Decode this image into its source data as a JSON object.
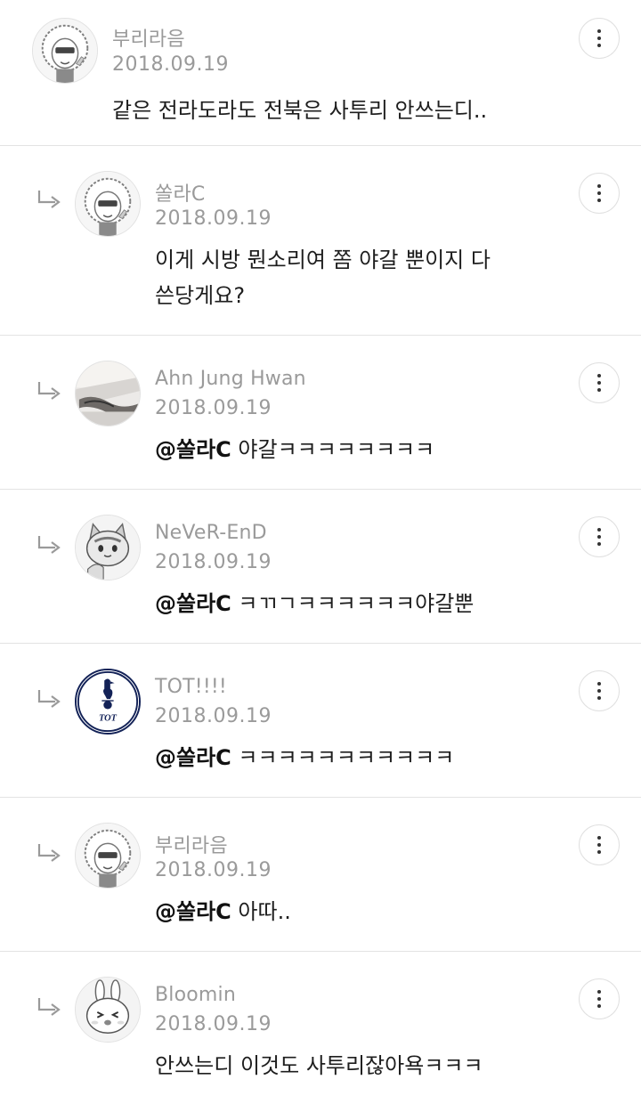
{
  "comments": [
    {
      "author": "부리라음",
      "date": "2018.09.19",
      "avatar_icon": "kakao-muzi-character-icon",
      "mention": "",
      "text": "같은 전라도라도 전북은 사투리 안쓰는디..",
      "is_reply": false
    },
    {
      "author": "쏠라C",
      "date": "2018.09.19",
      "avatar_icon": "kakao-muzi-character-icon",
      "mention": "",
      "text": "이게 시방 뭔소리여 쫌 야갈 뿐이지 다\n쓴당게요?",
      "is_reply": true
    },
    {
      "author": "Ahn Jung Hwan",
      "date": "2018.09.19",
      "avatar_icon": "photo-avatar-icon",
      "mention": "@쏠라C",
      "text": " 야갈ㅋㅋㅋㅋㅋㅋㅋㅋ",
      "is_reply": true
    },
    {
      "author": "NeVeR-EnD",
      "date": "2018.09.19",
      "avatar_icon": "cat-character-icon",
      "mention": "@쏠라C",
      "text": " ㅋㄲㄱㅋㅋㅋㅋㅋㅋ야갈뿐",
      "is_reply": true
    },
    {
      "author": "TOT!!!!",
      "date": "2018.09.19",
      "avatar_icon": "tottenham-logo-icon",
      "mention": "@쏠라C",
      "text": " ㅋㅋㅋㅋㅋㅋㅋㅋㅋㅋㅋ",
      "is_reply": true
    },
    {
      "author": "부리라음",
      "date": "2018.09.19",
      "avatar_icon": "kakao-muzi-character-icon",
      "mention": "@쏠라C",
      "text": " 아따..",
      "is_reply": true
    },
    {
      "author": "Bloomin",
      "date": "2018.09.19",
      "avatar_icon": "rabbit-character-icon",
      "mention": "",
      "text": "안쓰는디 이것도 사투리잖아욕ㅋㅋㅋ",
      "is_reply": true
    }
  ],
  "avatar_badge_text": "TOT",
  "colors": {
    "meta_text": "#9a9a9a",
    "body_text": "#1e1e1e",
    "divider": "#e3e3e3",
    "tottenham_navy": "#132257"
  }
}
